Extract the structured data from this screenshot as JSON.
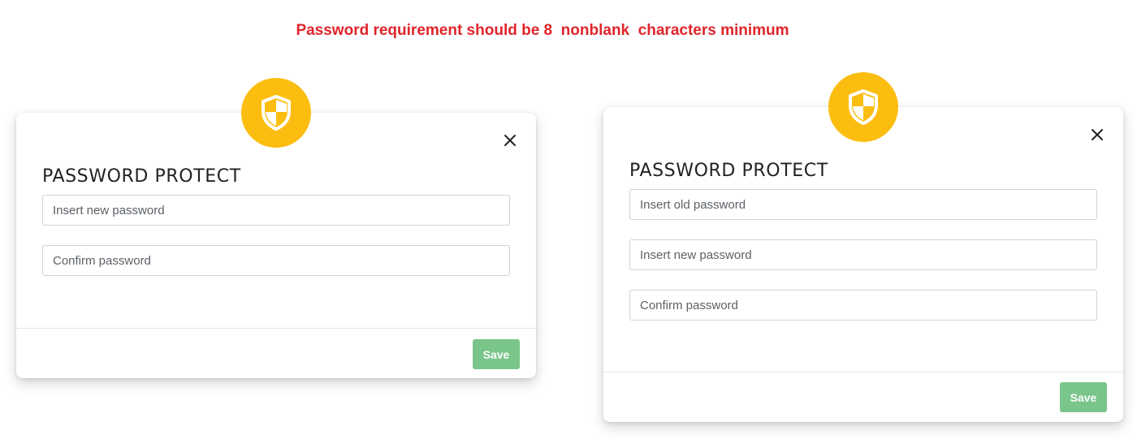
{
  "requirement_text": "Password requirement should be 8  nonblank  characters minimum",
  "colors": {
    "requirement": "#e0242b",
    "badge": "#fbbd10",
    "save_button": "#7ac58a"
  },
  "modals": [
    {
      "title": "PASSWORD PROTECT",
      "badge_icon": "shield-icon",
      "close_icon": "close-icon",
      "fields": [
        {
          "placeholder": "Insert new password"
        },
        {
          "placeholder": "Confirm password"
        }
      ],
      "save_label": "Save"
    },
    {
      "title": "PASSWORD PROTECT",
      "badge_icon": "shield-icon",
      "close_icon": "close-icon",
      "fields": [
        {
          "placeholder": "Insert old password"
        },
        {
          "placeholder": "Insert new password"
        },
        {
          "placeholder": "Confirm password"
        }
      ],
      "save_label": "Save"
    }
  ]
}
